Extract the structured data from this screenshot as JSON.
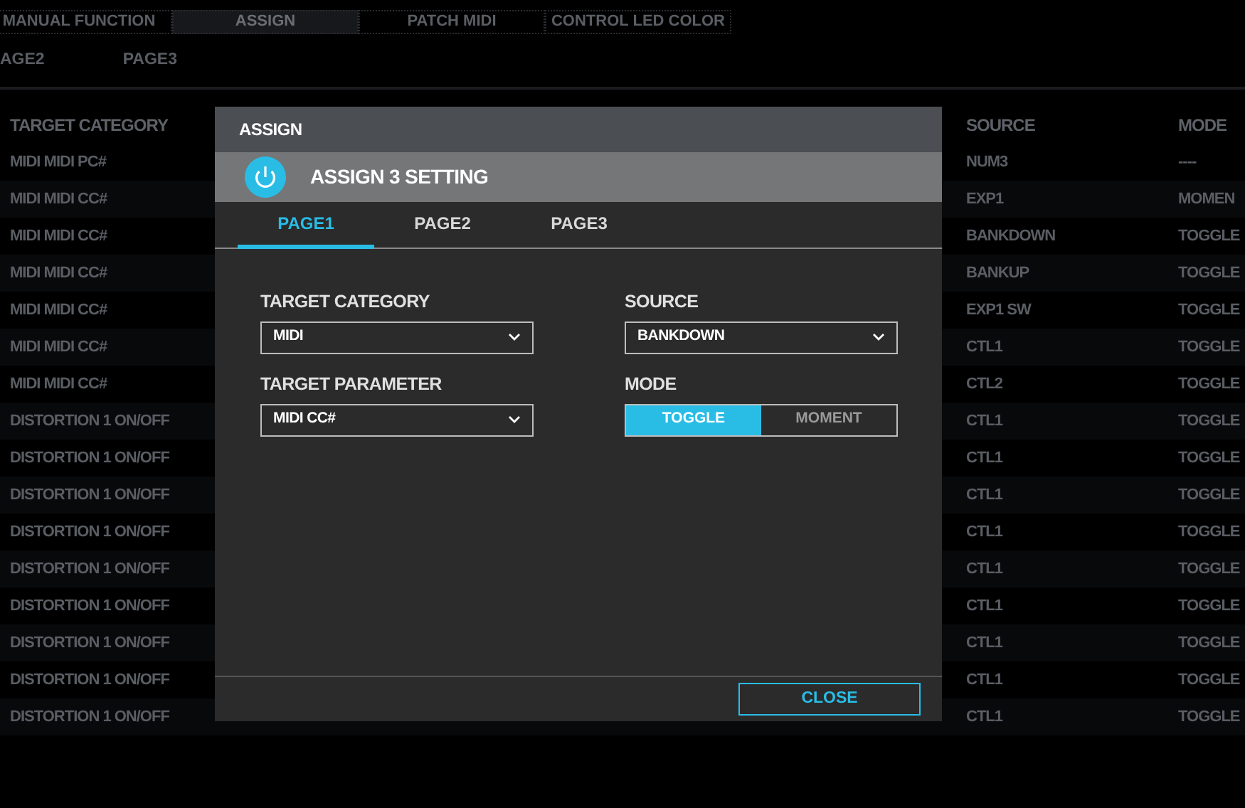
{
  "top_tabs": [
    {
      "label": "MANUAL FUNCTION",
      "selected": false
    },
    {
      "label": "ASSIGN",
      "selected": true
    },
    {
      "label": "PATCH MIDI",
      "selected": false
    },
    {
      "label": "CONTROL LED COLOR",
      "selected": false
    }
  ],
  "sub_tabs": [
    {
      "label": "AGE2",
      "selected": false
    },
    {
      "label": "PAGE3",
      "selected": false
    }
  ],
  "table": {
    "columns": [
      "TARGET CATEGORY",
      "SOURCE",
      "MODE"
    ],
    "rows": [
      [
        "MIDI MIDI PC#",
        "NUM3",
        "----"
      ],
      [
        "MIDI MIDI CC#",
        "EXP1",
        "MOMEN"
      ],
      [
        "MIDI MIDI CC#",
        "BANKDOWN",
        "TOGGLE"
      ],
      [
        "MIDI MIDI CC#",
        "BANKUP",
        "TOGGLE"
      ],
      [
        "MIDI MIDI CC#",
        "EXP1 SW",
        "TOGGLE"
      ],
      [
        "MIDI MIDI CC#",
        "CTL1",
        "TOGGLE"
      ],
      [
        "MIDI MIDI CC#",
        "CTL2",
        "TOGGLE"
      ],
      [
        "DISTORTION 1 ON/OFF",
        "CTL1",
        "TOGGLE"
      ],
      [
        "DISTORTION 1 ON/OFF",
        "CTL1",
        "TOGGLE"
      ],
      [
        "DISTORTION 1 ON/OFF",
        "CTL1",
        "TOGGLE"
      ],
      [
        "DISTORTION 1 ON/OFF",
        "CTL1",
        "TOGGLE"
      ],
      [
        "DISTORTION 1 ON/OFF",
        "CTL1",
        "TOGGLE"
      ],
      [
        "DISTORTION 1 ON/OFF",
        "CTL1",
        "TOGGLE"
      ],
      [
        "DISTORTION 1 ON/OFF",
        "CTL1",
        "TOGGLE"
      ],
      [
        "DISTORTION 1 ON/OFF",
        "CTL1",
        "TOGGLE"
      ],
      [
        "DISTORTION 1 ON/OFF",
        "CTL1",
        "TOGGLE"
      ]
    ]
  },
  "dialog": {
    "title": "ASSIGN",
    "heading": "ASSIGN 3 SETTING",
    "tabs": [
      {
        "label": "PAGE1",
        "selected": true
      },
      {
        "label": "PAGE2",
        "selected": false
      },
      {
        "label": "PAGE3",
        "selected": false
      }
    ],
    "columns": [
      [
        {
          "kind": "select",
          "label": "TARGET CATEGORY",
          "value": "MIDI"
        },
        {
          "kind": "select",
          "label": "TARGET PARAMETER",
          "value": "MIDI CC#"
        }
      ],
      [
        {
          "kind": "select",
          "label": "SOURCE",
          "value": "BANKDOWN"
        },
        {
          "kind": "segmented",
          "label": "MODE",
          "options": [
            {
              "label": "TOGGLE",
              "selected": true
            },
            {
              "label": "MOMENT",
              "selected": false
            }
          ]
        }
      ]
    ],
    "close_button": "CLOSE"
  }
}
